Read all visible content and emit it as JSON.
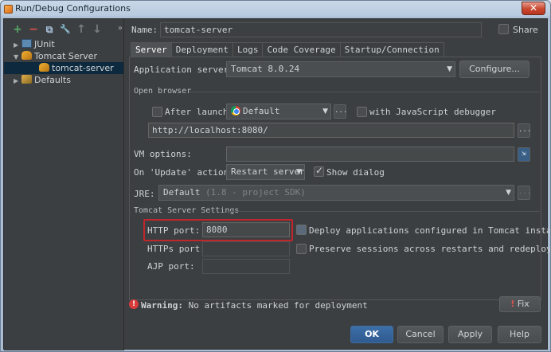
{
  "window": {
    "title": "Run/Debug Configurations",
    "close_glyph": "✕"
  },
  "toolbar": {
    "add": "+",
    "remove": "−",
    "copy": "⧉",
    "settings": "🔧",
    "up": "↑",
    "down": "↓",
    "more": "»"
  },
  "tree": [
    {
      "label": "JUnit",
      "arrow": "▶",
      "level": 0,
      "icon": "junit-icon"
    },
    {
      "label": "Tomcat Server",
      "arrow": "▼",
      "level": 0,
      "icon": "tomcat-icon"
    },
    {
      "label": "tomcat-server",
      "arrow": "",
      "level": 1,
      "icon": "tomcat-icon",
      "selected": true
    },
    {
      "label": "Defaults",
      "arrow": "▶",
      "level": 0,
      "icon": "wrench-icon"
    }
  ],
  "name_label": "Name:",
  "name_value": "tomcat-server",
  "share_label": "Share",
  "tabs": [
    "Server",
    "Deployment",
    "Logs",
    "Code Coverage",
    "Startup/Connection"
  ],
  "server": {
    "app_server_label": "Application server:",
    "app_server_value": "Tomcat 8.0.24",
    "configure_label": "Configure...",
    "open_browser_title": "Open browser",
    "after_launch_label": "After launch",
    "browser_value": "Default",
    "js_debugger_label": "with JavaScript debugger",
    "url_value": "http://localhost:8080/",
    "ellipsis": "...",
    "vm_options_label": "VM options:",
    "on_update_label": "On 'Update' action:",
    "on_update_value": "Restart server",
    "show_dialog_label": "Show dialog",
    "jre_label": "JRE:",
    "jre_value": "Default",
    "jre_hint": "(1.8 - project SDK)",
    "tomcat_settings_title": "Tomcat Server Settings",
    "http_port_label": "HTTP port:",
    "http_port_value": "8080",
    "https_port_label": "HTTPs port:",
    "ajp_port_label": "AJP port:",
    "deploy_label": "Deploy applications configured in Tomcat instance",
    "preserve_label": "Preserve sessions across restarts and redeploys"
  },
  "warning": {
    "bold": "Warning:",
    "text": "No artifacts marked for deployment",
    "fix_label": "Fix"
  },
  "footer": {
    "ok": "OK",
    "cancel": "Cancel",
    "apply": "Apply",
    "help": "Help"
  }
}
